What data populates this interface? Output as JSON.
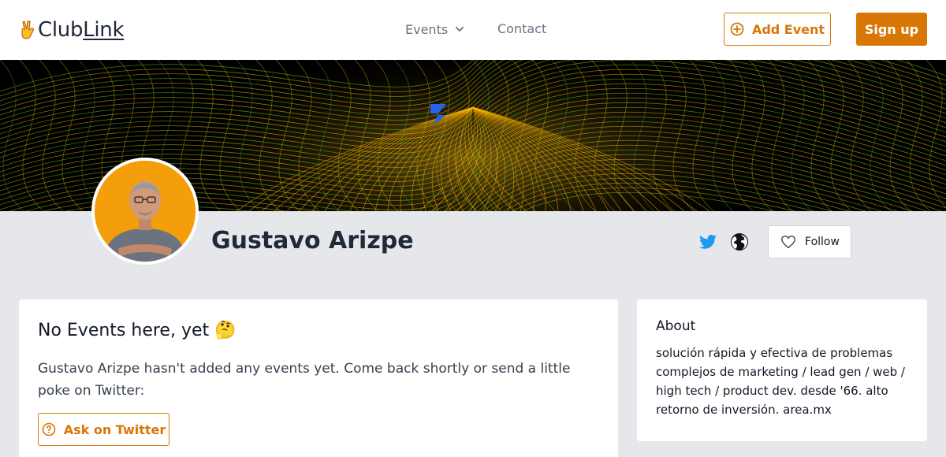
{
  "header": {
    "logo_text_a": "Club",
    "logo_text_b": "Link",
    "nav": {
      "events_label": "Events",
      "contact_label": "Contact"
    },
    "add_event_label": "Add Event",
    "sign_up_label": "Sign up"
  },
  "profile": {
    "name": "Gustavo Arizpe",
    "follow_label": "Follow"
  },
  "events": {
    "title": "No Events here, yet 🤔",
    "message": "Gustavo Arizpe hasn't added any events yet. Come back shortly or send a little poke on Twitter:",
    "ask_label": "Ask on Twitter"
  },
  "about": {
    "title": "About",
    "text": "solución rápida y efectiva de problemas complejos de marketing / lead gen / web / high tech / product dev. desde '66. alto retorno de inversión. area.mx"
  },
  "colors": {
    "accent": "#d97706",
    "twitter": "#1d9bf0",
    "page_bg": "#e5e7eb"
  }
}
